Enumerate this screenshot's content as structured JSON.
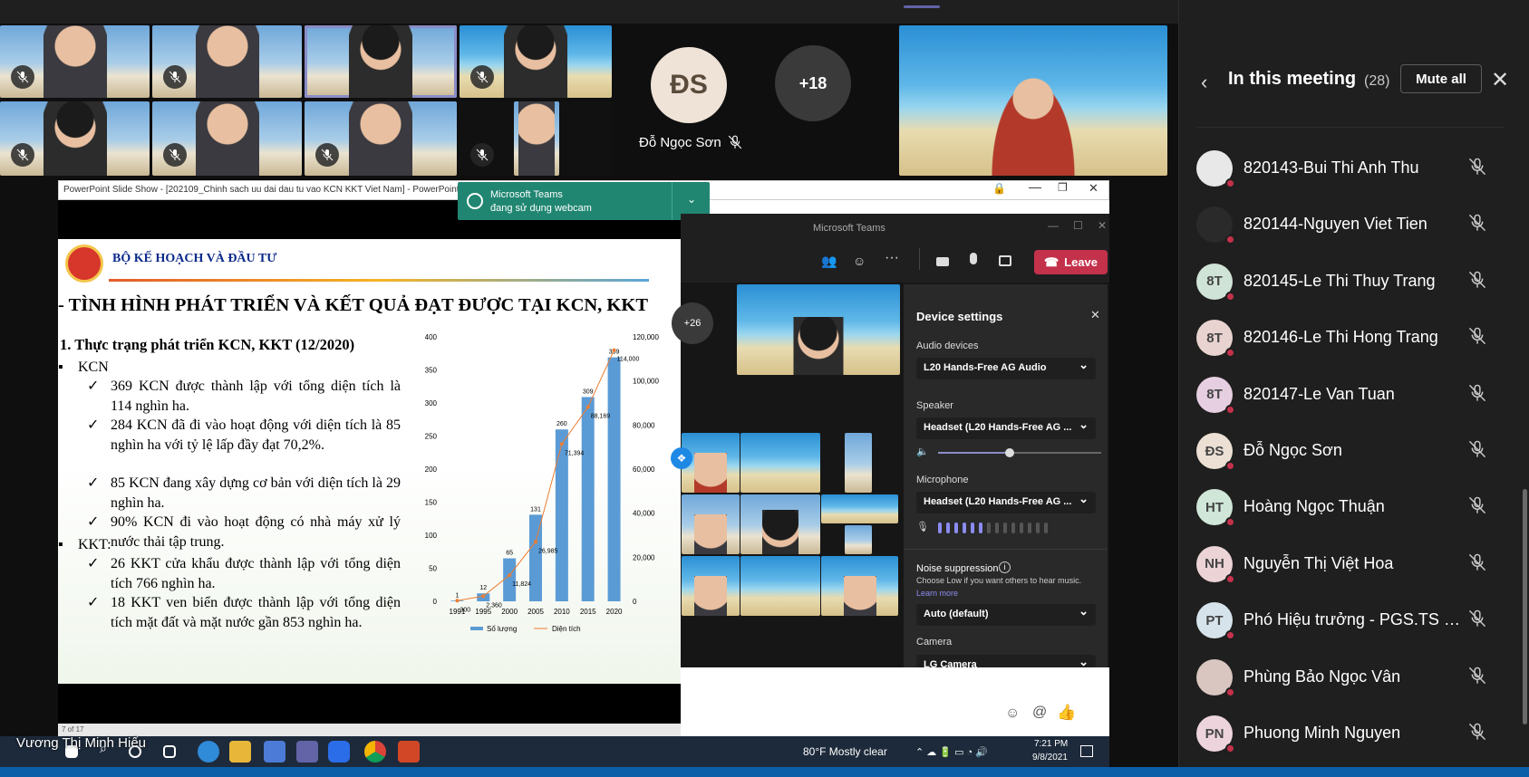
{
  "participants_grid": {
    "tiles": [
      {
        "muted": true
      },
      {
        "muted": true
      },
      {
        "muted": false
      },
      {
        "muted": true
      },
      {
        "muted": true
      },
      {
        "muted": true
      },
      {
        "muted": true
      },
      {
        "muted": true
      }
    ],
    "avatar_tile": {
      "initials": "ĐS",
      "name": "Đỗ Ngọc Sơn"
    },
    "overflow_tile": {
      "label": "+18"
    }
  },
  "panel": {
    "title": "In this meeting",
    "count": "(28)",
    "mute_all": "Mute all",
    "people": [
      {
        "name": "820143-Bui Thi Anh Thu",
        "initials": "",
        "color": "#e8e8e8"
      },
      {
        "name": "820144-Nguyen Viet Tien",
        "initials": "",
        "color": "#2a2a2a"
      },
      {
        "name": "820145-Le Thi Thuy Trang",
        "initials": "8T",
        "color": "#cfe3d6"
      },
      {
        "name": "820146-Le Thi Hong Trang",
        "initials": "8T",
        "color": "#e9d3d0"
      },
      {
        "name": "820147-Le Van Tuan",
        "initials": "8T",
        "color": "#e6cfe0"
      },
      {
        "name": "Đỗ Ngọc Sơn",
        "initials": "ĐS",
        "color": "#ece0d4"
      },
      {
        "name": "Hoàng Ngọc Thuận",
        "initials": "HT",
        "color": "#cfe6d8"
      },
      {
        "name": "Nguyễn Thị Việt Hoa",
        "initials": "NH",
        "color": "#ecd3d6"
      },
      {
        "name": "Phó Hiệu trưởng - PGS.TS Đà...",
        "initials": "PT",
        "color": "#d6e3ea"
      },
      {
        "name": "Phùng Bảo Ngọc Vân",
        "initials": "",
        "color": "#d9c6c0"
      },
      {
        "name": "Phuong Minh Nguyen",
        "initials": "PN",
        "color": "#ecd3dc"
      }
    ]
  },
  "ppt": {
    "window_title": "PowerPoint Slide Show - [202109_Chinh sach uu dai dau tu vao KCN KKT Viet Nam] - PowerPoint",
    "slide": {
      "org": "BỘ KẾ HOẠCH VÀ ĐẦU TƯ",
      "heading": "- TÌNH HÌNH PHÁT TRIỂN VÀ KẾT QUẢ ĐẠT ĐƯỢC TẠI KCN, KKT",
      "subheading": "1. Thực trạng phát triển KCN, KKT (12/2020)",
      "kcn_label": "KCN",
      "kcn_items": [
        "369 KCN được thành lập với tổng diện tích là 114 nghìn ha.",
        "284 KCN đã đi vào hoạt động với diện tích là 85 nghìn ha với tỷ lệ lấp đầy đạt 70,2%.",
        "85 KCN đang xây dựng cơ bản với diện tích là 29 nghìn ha.",
        "90% KCN đi vào hoạt động có nhà máy xử lý nước thải tập trung."
      ],
      "kkt_label": "KKT:",
      "kkt_items": [
        "26 KKT cửa khẩu được thành lập với tổng diện tích 766 nghìn ha.",
        "18 KKT ven biển được thành lập với tổng diện tích mặt đất và mặt nước gần 853 nghìn ha."
      ]
    },
    "status_text": "7 of 17"
  },
  "chart_data": {
    "type": "bar",
    "categories": [
      "1991",
      "1995",
      "2000",
      "2005",
      "2010",
      "2015",
      "2020"
    ],
    "series": [
      {
        "name": "Số lượng",
        "type": "bar",
        "values": [
          1,
          12,
          65,
          131,
          260,
          309,
          369
        ],
        "labels": [
          "1",
          "12",
          "65",
          "131",
          "260",
          "309",
          "369"
        ],
        "color": "#5b9bd5"
      },
      {
        "name": "Diện tích",
        "type": "line",
        "values": [
          300,
          2360,
          11824,
          26985,
          71394,
          88169,
          114000
        ],
        "labels": [
          "300",
          "2,360",
          "11,824",
          "26,985",
          "71,394",
          "88,169",
          "114,000"
        ],
        "color": "#ed7d31"
      }
    ],
    "y_left": {
      "min": 0,
      "max": 400,
      "ticks": [
        "0",
        "50",
        "100",
        "150",
        "200",
        "250",
        "300",
        "350",
        "400"
      ]
    },
    "y_right": {
      "min": 0,
      "max": 120000,
      "ticks": [
        "0",
        "20,000",
        "40,000",
        "60,000",
        "80,000",
        "100,000",
        "120,000"
      ]
    },
    "legend_position": "bottom"
  },
  "toast": {
    "title": "Microsoft Teams",
    "body": "đang sử dụng webcam"
  },
  "teams": {
    "window_title": "Microsoft Teams",
    "leave_label": "Leave",
    "overflow_label": "+26",
    "device_settings": {
      "title": "Device settings",
      "audio_label": "Audio devices",
      "audio_value": "L20 Hands-Free AG Audio",
      "speaker_label": "Speaker",
      "speaker_value": "Headset (L20 Hands-Free AG ...",
      "speaker_volume": 0.44,
      "mic_label": "Microphone",
      "mic_value": "Headset (L20 Hands-Free AG ...",
      "mic_level_bars": 6,
      "noise_label": "Noise suppression",
      "noise_desc": "Choose Low if you want others to hear music.",
      "learn_more": "Learn more",
      "noise_value": "Auto (default)",
      "camera_label": "Camera",
      "camera_value": "LG Camera"
    }
  },
  "taskbar": {
    "weather": "80°F  Mostly clear",
    "time": "7:21 PM",
    "date": "9/8/2021"
  },
  "speaker_name": "Vương Thị Minh Hiếu"
}
